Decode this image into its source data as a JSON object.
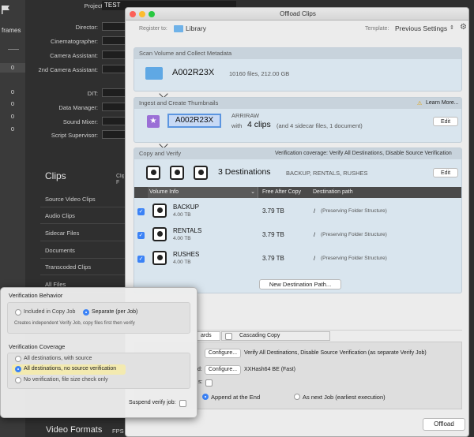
{
  "background": {
    "project_label": "Project Name:",
    "project_value": "TEST",
    "left_labels": [
      "frames"
    ],
    "left_nums": [
      "0",
      "0",
      "0",
      "0",
      "0"
    ],
    "fields": [
      "Director:",
      "Cinematographer:",
      "Camera Assistant:",
      "2nd Camera Assistant:",
      "DIT:",
      "Data Manager:",
      "Sound Mixer:",
      "Script Supervisor:"
    ],
    "clips_title": "Clips",
    "clips_cut_text": "Clip\nF",
    "sidebar_items": [
      "Source Video Clips",
      "Audio Clips",
      "Sidecar Files",
      "Documents",
      "Transcoded Clips",
      "All Files"
    ],
    "video_formats": "Video Formats",
    "fps_cut": "FPS"
  },
  "dialog": {
    "title": "Offload Clips",
    "register_label": "Register to:",
    "register_value": "Library",
    "template_label": "Template:",
    "template_value": "Previous Settings",
    "scan": {
      "header": "Scan Volume and Collect Metadata",
      "volume_name": "A002R23X",
      "volume_info": "10160 files, 212.00 GB"
    },
    "ingest": {
      "header": "Ingest and Create Thumbnails",
      "learn_more": "Learn More...",
      "clip_name": "A002R23X",
      "format": "ARRIRAW",
      "with_label": "with",
      "clips_count": "4 clips",
      "extra": "(and 4 sidecar files, 1 document)",
      "edit": "Edit"
    },
    "copy": {
      "header": "Copy and Verify",
      "coverage": "Verification coverage: Verify All Destinations, Disable Source Verification",
      "dest_count": "3 Destinations",
      "dest_names": "BACKUP, RENTALS, RUSHES",
      "edit": "Edit",
      "columns": [
        "Volume Info",
        "Free After Copy",
        "Destination path"
      ],
      "rows": [
        {
          "name": "BACKUP",
          "size": "4.00 TB",
          "free": "3.79 TB",
          "path": "/",
          "note": "(Preserving Folder Structure)"
        },
        {
          "name": "RENTALS",
          "size": "4.00 TB",
          "free": "3.79 TB",
          "path": "/",
          "note": "(Preserving Folder Structure)"
        },
        {
          "name": "RUSHES",
          "size": "4.00 TB",
          "free": "3.79 TB",
          "path": "/",
          "note": "(Preserving Folder Structure)"
        }
      ],
      "new_dest": "New Destination Path..."
    },
    "tabs": {
      "tab1_cut": "ards",
      "tab2": "Cascading Copy"
    },
    "options": {
      "configure1": "Configure...",
      "verify_text": "Verify All Destinations, Disable Source Verification (as separate Verify Job)",
      "label2_cut": "d:",
      "configure2": "Configure...",
      "hash": "XXHash64 BE (Fast)",
      "label3_cut": "s:",
      "append": "Append at the End",
      "next_job": "As next Job (earliest execution)"
    },
    "offload": "Offload"
  },
  "popover": {
    "behavior_title": "Verification Behavior",
    "behavior_opt1": "Included in Copy Job",
    "behavior_opt2": "Separate (per Job)",
    "behavior_desc": "Creates independent Verify Job, copy files first then verify",
    "coverage_title": "Verification Coverage",
    "cov_opt1": "All destinations, with source",
    "cov_opt2": "All destinations, no source verification",
    "cov_opt3": "No verification, file size check only",
    "suspend": "Suspend verify job:"
  },
  "colors": {
    "accent": "#3b82f6",
    "highlight": "#f3eab0",
    "section_bg": "#d9e5ee"
  }
}
